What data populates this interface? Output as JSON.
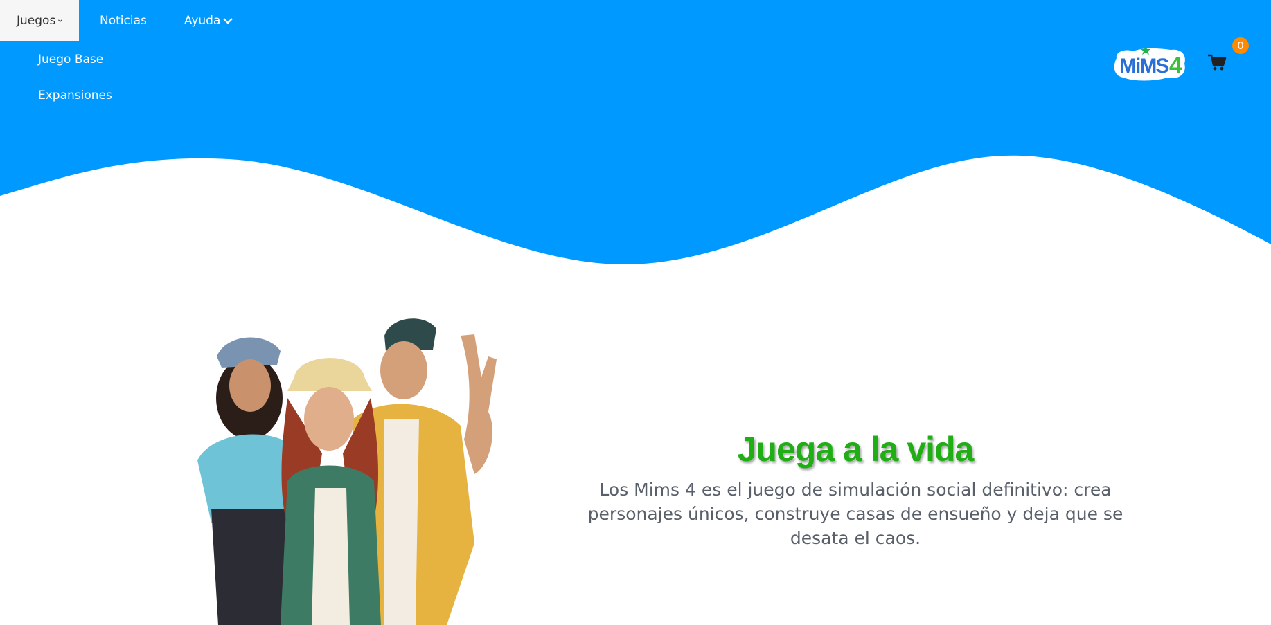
{
  "nav": {
    "items": [
      {
        "label": "Juegos",
        "has_dropdown": true,
        "active": true
      },
      {
        "label": "Noticias",
        "has_dropdown": false
      },
      {
        "label": "Ayuda",
        "has_dropdown": true
      }
    ],
    "dropdown": [
      "Juego Base",
      "Expansiones"
    ]
  },
  "brand": {
    "logo_text": "MiMS4"
  },
  "cart": {
    "count": "0"
  },
  "hero": {
    "title": "Juega a la vida",
    "description": "Los Mims 4 es el juego de simulación social definitivo: crea personajes únicos, construye casas de ensueño y deja que se desata el caos."
  },
  "colors": {
    "primary": "#0099ff",
    "accent_green": "#1fae14",
    "badge": "#ff8a00"
  }
}
